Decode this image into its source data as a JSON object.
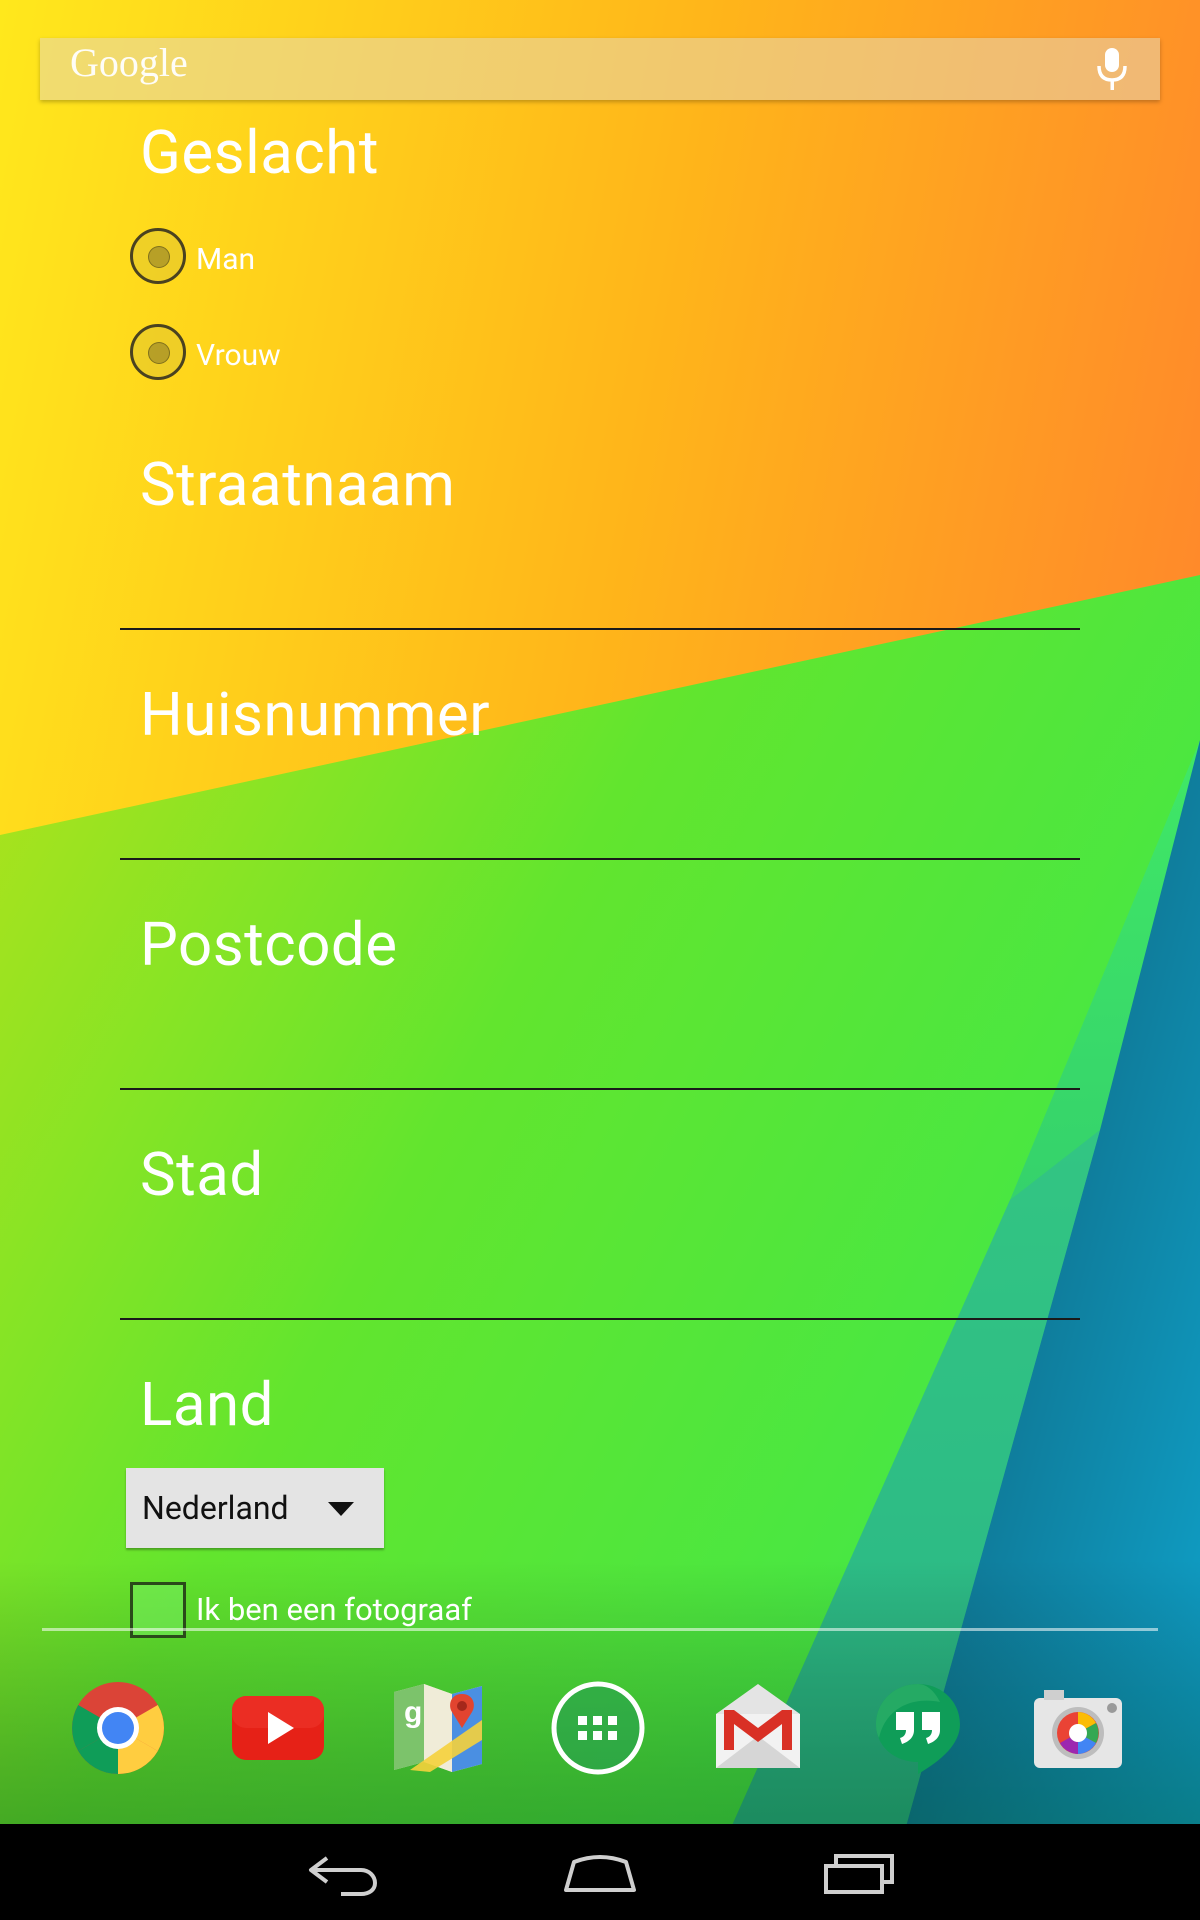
{
  "search_bar": {
    "logo": "Google",
    "mic_icon": "microphone-icon"
  },
  "form": {
    "gender": {
      "label": "Geslacht",
      "options": [
        "Man",
        "Vrouw"
      ]
    },
    "street": {
      "label": "Straatnaam",
      "value": ""
    },
    "house_number": {
      "label": "Huisnummer",
      "value": ""
    },
    "postcode": {
      "label": "Postcode",
      "value": ""
    },
    "city": {
      "label": "Stad",
      "value": ""
    },
    "country": {
      "label": "Land",
      "selected": "Nederland"
    },
    "photographer": {
      "label": "Ik ben een fotograaf",
      "checked": false
    }
  },
  "dock": {
    "apps": [
      "chrome-icon",
      "youtube-icon",
      "maps-icon",
      "app-drawer-icon",
      "gmail-icon",
      "hangouts-icon",
      "camera-icon"
    ]
  },
  "navbar": {
    "buttons": [
      "back-icon",
      "home-icon",
      "recents-icon"
    ]
  },
  "colors": {
    "text": "#ffffff",
    "divider": "#1a1a1a",
    "select_bg": "#e4e4e4"
  }
}
